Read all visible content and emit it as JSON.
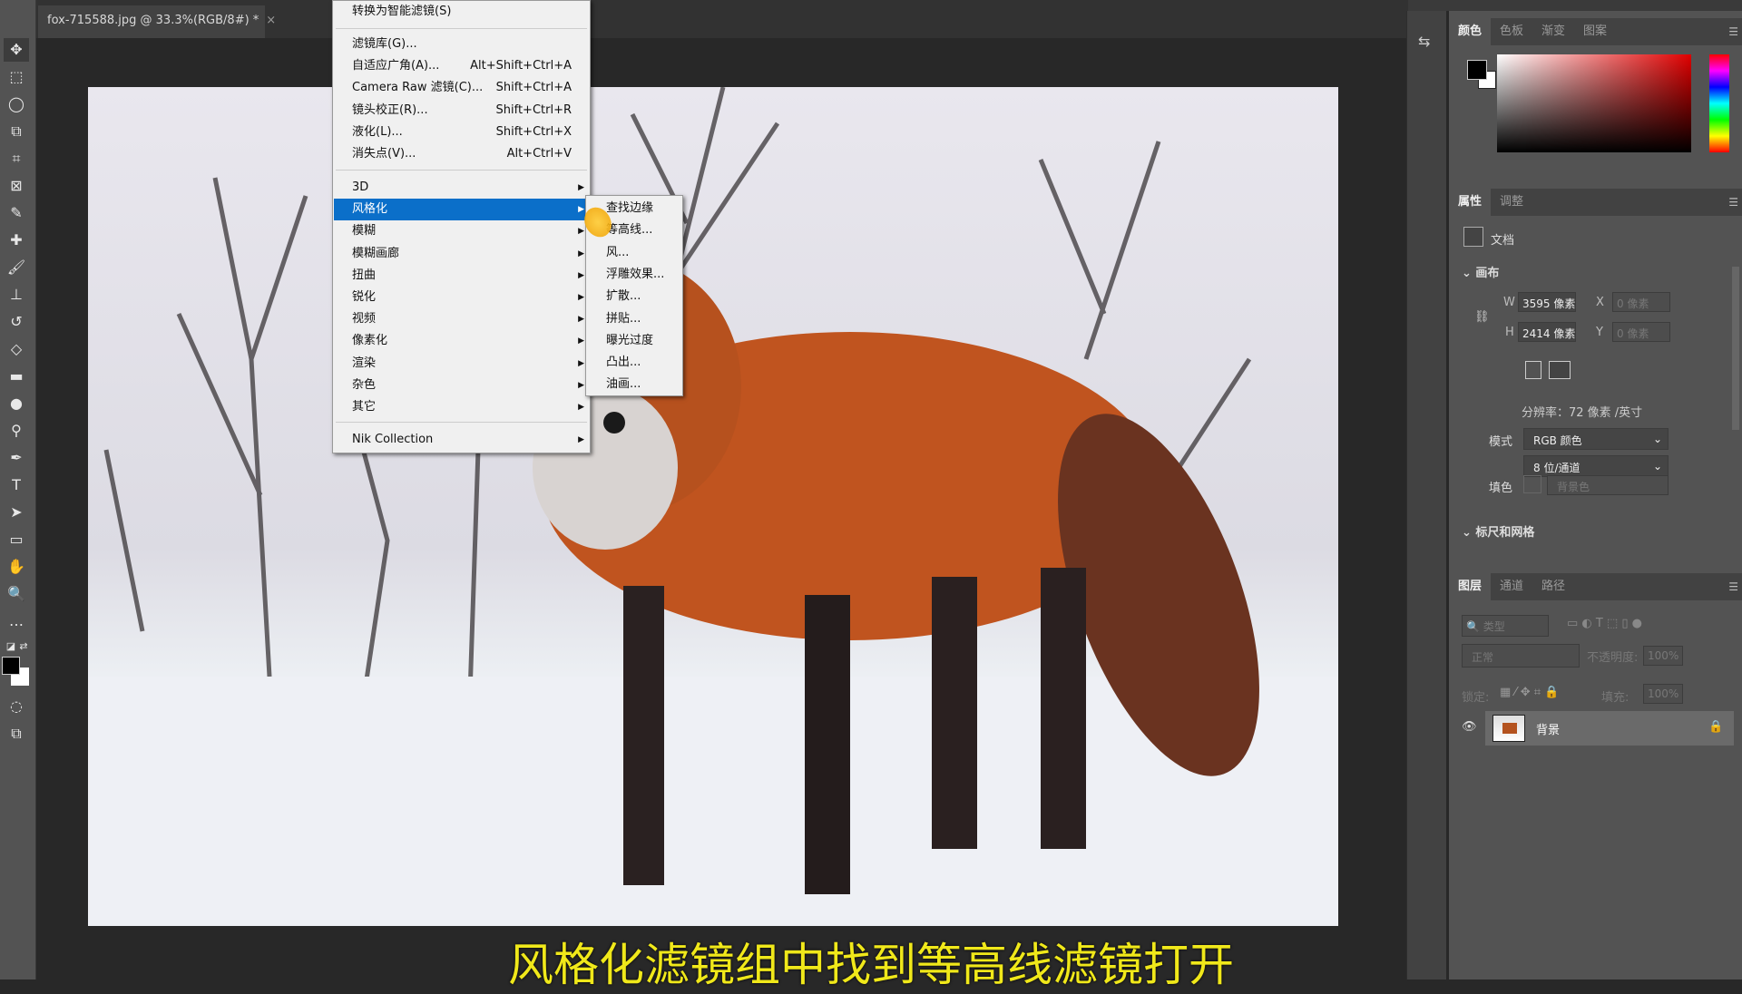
{
  "document_tab": {
    "title": "fox-715588.jpg @ 33.3%(RGB/8#) *",
    "close": "×"
  },
  "tools": [
    "move",
    "marquee",
    "lasso",
    "object-select",
    "crop",
    "frame",
    "eyedropper",
    "healing",
    "brush",
    "stamp",
    "history-brush",
    "eraser",
    "gradient",
    "blur",
    "dodge",
    "pen",
    "type",
    "path-select",
    "rectangle",
    "hand",
    "zoom",
    "more"
  ],
  "filter_menu": {
    "items": [
      {
        "label": "转换为智能滤镜(S)",
        "shortcut": ""
      },
      {
        "label": "滤镜库(G)...",
        "shortcut": ""
      },
      {
        "label": "自适应广角(A)...",
        "shortcut": "Alt+Shift+Ctrl+A"
      },
      {
        "label": "Camera Raw 滤镜(C)...",
        "shortcut": "Shift+Ctrl+A"
      },
      {
        "label": "镜头校正(R)...",
        "shortcut": "Shift+Ctrl+R"
      },
      {
        "label": "液化(L)...",
        "shortcut": "Shift+Ctrl+X"
      },
      {
        "label": "消失点(V)...",
        "shortcut": "Alt+Ctrl+V"
      }
    ],
    "groups": [
      "3D",
      "风格化",
      "模糊",
      "模糊画廊",
      "扭曲",
      "锐化",
      "视频",
      "像素化",
      "渲染",
      "杂色",
      "其它"
    ],
    "highlighted": "风格化",
    "nik": "Nik Collection"
  },
  "stylize_submenu": [
    "查找边缘",
    "等高线...",
    "风...",
    "浮雕效果...",
    "扩散...",
    "拼贴...",
    "曝光过度",
    "凸出...",
    "油画..."
  ],
  "subtitle": "风格化滤镜组中找到等高线滤镜打开",
  "color_panel": {
    "tabs": [
      "颜色",
      "色板",
      "渐变",
      "图案"
    ],
    "foreground": "#000000",
    "background": "#ffffff",
    "hue": "#e00000"
  },
  "properties_panel": {
    "tabs": [
      "属性",
      "调整"
    ],
    "doc_label": "文档",
    "canvas_section": "画布",
    "w_label": "W",
    "w_value": "3595 像素",
    "h_label": "H",
    "h_value": "2414 像素",
    "x_label": "X",
    "x_value": "0 像素",
    "y_label": "Y",
    "y_value": "0 像素",
    "resolution": "分辨率：72 像素 /英寸",
    "mode_label": "模式",
    "mode_value": "RGB 颜色",
    "depth_value": "8 位/通道",
    "fill_label": "填色",
    "fill_value": "背景色",
    "rulers_section": "标尺和网格"
  },
  "layers_panel": {
    "tabs": [
      "图层",
      "通道",
      "路径"
    ],
    "filter_kind": "类型",
    "blend_mode": "正常",
    "opacity_label": "不透明度:",
    "opacity_value": "100%",
    "lock_label": "锁定:",
    "fill_label": "填充:",
    "fill_value": "100%",
    "layers": [
      {
        "name": "背景",
        "visible": true,
        "locked": true
      }
    ]
  }
}
